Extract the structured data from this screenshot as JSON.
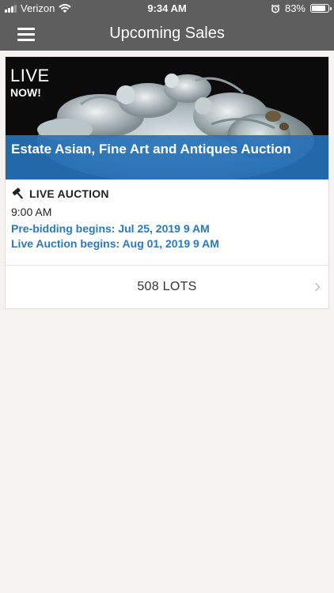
{
  "status_bar": {
    "carrier": "Verizon",
    "time": "9:34 AM",
    "battery_percent": "83%",
    "battery_level": 0.83
  },
  "nav": {
    "title": "Upcoming Sales"
  },
  "sale": {
    "live_label": "LIVE",
    "now_label": "NOW!",
    "title": "Estate Asian, Fine Art and Antiques Auction",
    "auction_type": "LIVE AUCTION",
    "time": "9:00 AM",
    "prebid": "Pre-bidding begins: Jul 25, 2019 9 AM",
    "live_begins": "Live Auction begins: Aug 01, 2019 9 AM",
    "lots_label": "508 LOTS"
  },
  "colors": {
    "nav_bg": "#5e5e5e",
    "accent_blue": "#2a78bd",
    "page_bg": "#f4f3ef"
  }
}
